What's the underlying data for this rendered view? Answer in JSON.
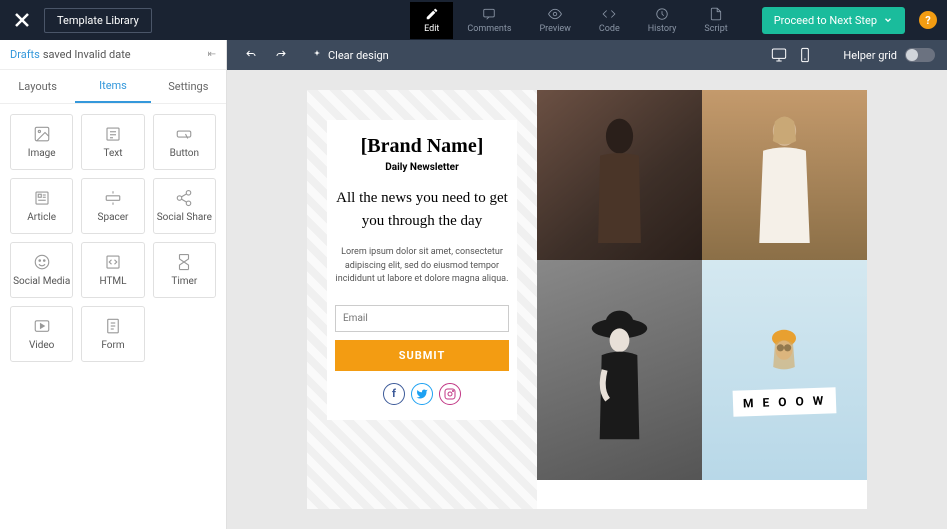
{
  "topbar": {
    "template_library": "Template Library",
    "tabs": [
      {
        "label": "Edit",
        "active": true
      },
      {
        "label": "Comments"
      },
      {
        "label": "Preview"
      },
      {
        "label": "Code"
      },
      {
        "label": "History"
      },
      {
        "label": "Script"
      }
    ],
    "proceed": "Proceed to Next Step",
    "help": "?"
  },
  "sidebar": {
    "drafts_label": "Drafts",
    "drafts_status": "saved Invalid date",
    "tabs": [
      {
        "label": "Layouts"
      },
      {
        "label": "Items",
        "active": true
      },
      {
        "label": "Settings"
      }
    ],
    "items": [
      {
        "label": "Image"
      },
      {
        "label": "Text"
      },
      {
        "label": "Button"
      },
      {
        "label": "Article"
      },
      {
        "label": "Spacer"
      },
      {
        "label": "Social Share"
      },
      {
        "label": "Social Media"
      },
      {
        "label": "HTML"
      },
      {
        "label": "Timer"
      },
      {
        "label": "Video"
      },
      {
        "label": "Form"
      }
    ]
  },
  "canvas_bar": {
    "clear": "Clear design",
    "helper": "Helper grid"
  },
  "email": {
    "brand": "[Brand Name]",
    "daily": "Daily Newsletter",
    "headline": "All the news you need to get you through the day",
    "lorem": "Lorem ipsum dolor sit amet, consectetur adipiscing elit, sed do eiusmod tempor incididunt ut labore et dolore magna aliqua.",
    "email_placeholder": "Email",
    "submit": "SUBMIT",
    "meow": "M E O O W"
  }
}
